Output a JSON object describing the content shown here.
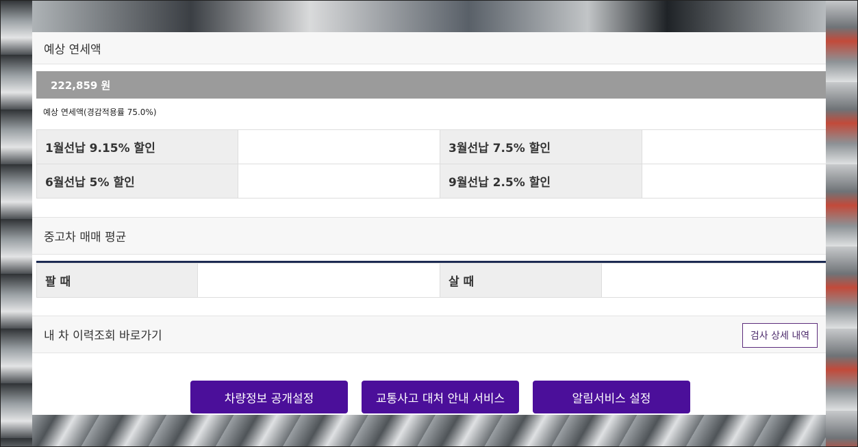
{
  "tax": {
    "title": "예상 연세액",
    "amount": "222,859 원",
    "note": "예상 연세액(경감적용률 75.0%)",
    "rows": [
      [
        {
          "label": "1월선납 9.15% 할인",
          "value": ""
        },
        {
          "label": "3월선납 7.5% 할인",
          "value": ""
        }
      ],
      [
        {
          "label": "6월선납 5% 할인",
          "value": ""
        },
        {
          "label": "9월선납 2.5% 할인",
          "value": ""
        }
      ]
    ]
  },
  "used_car": {
    "title": "중고차 매매 평균",
    "sell_label": "팔 때",
    "sell_value": "",
    "buy_label": "살 때",
    "buy_value": ""
  },
  "history": {
    "title": "내 차 이력조회 바로가기",
    "detail_button": "검사 상세 내역"
  },
  "actions": {
    "vehicle_info_button": "차량정보 공개설정",
    "accident_service_button": "교통사고 대처 안내 서비스",
    "alert_service_button": "알림서비스 설정"
  },
  "colors": {
    "primary_button": "#4b0f9a",
    "navy_rule": "#1c2a52",
    "amount_bar": "#9b9b9b"
  }
}
